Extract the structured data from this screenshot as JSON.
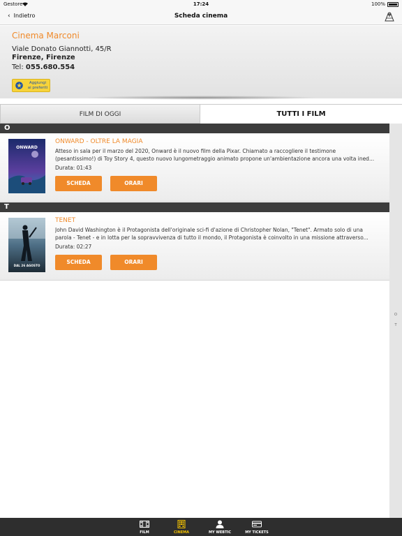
{
  "status_bar": {
    "carrier": "Gestore",
    "time": "17:24",
    "battery": "100%"
  },
  "nav": {
    "back_label": "Indietro",
    "title": "Scheda cinema"
  },
  "cinema": {
    "name": "Cinema Marconi",
    "address": "Viale Donato Giannotti, 45/R",
    "city": "Firenze, Firenze",
    "tel_label": "Tel:",
    "tel_number": "055.680.554",
    "favorite_line1": "Aggiungi",
    "favorite_line2": "ai preferiti"
  },
  "tabs": {
    "today": "FILM DI OGGI",
    "all": "TUTTI I FILM"
  },
  "sections": [
    {
      "letter": "O",
      "movie": {
        "title": "ONWARD - OLTRE LA MAGIA",
        "desc_line1": "Atteso in sala per il marzo del 2020, Onward è il nuovo film della Pixar. Chiamato a raccogliere il testimone",
        "desc_line2": "(pesantissimo!) di Toy Story 4, questo nuovo lungometraggio animato propone un'ambientazione ancora una volta ined...",
        "duration": "Durata: 01:43",
        "scheda": "SCHEDA",
        "orari": "ORARI",
        "poster_text": "ONWARD"
      }
    },
    {
      "letter": "T",
      "movie": {
        "title": "TENET",
        "desc_line1": "John David Washington è il Protagonista dell'originale sci-fi d'azione di Christopher Nolan, \"Tenet\". Armato solo di una",
        "desc_line2": "parola - Tenet - e in lotta per la sopravvivenza di tutto il mondo, il Protagonista è coinvolto in una missione attraverso...",
        "duration": "Durata: 02:27",
        "scheda": "SCHEDA",
        "orari": "ORARI",
        "poster_text": "DAL 26 AGOSTO"
      }
    }
  ],
  "index": [
    "O",
    "T"
  ],
  "tab_bar": {
    "items": [
      {
        "label": "FILM",
        "icon": "film-icon"
      },
      {
        "label": "CINEMA",
        "icon": "cinema-icon"
      },
      {
        "label": "MY WEBTIC",
        "icon": "user-icon"
      },
      {
        "label": "MY TICKETS",
        "icon": "ticket-icon"
      }
    ],
    "active": "CINEMA"
  },
  "colors": {
    "accent": "#f08a2a",
    "section_bg": "#3c3c3c",
    "tab_active": "#f7c400",
    "favorite_bg": "#f7d33a"
  }
}
